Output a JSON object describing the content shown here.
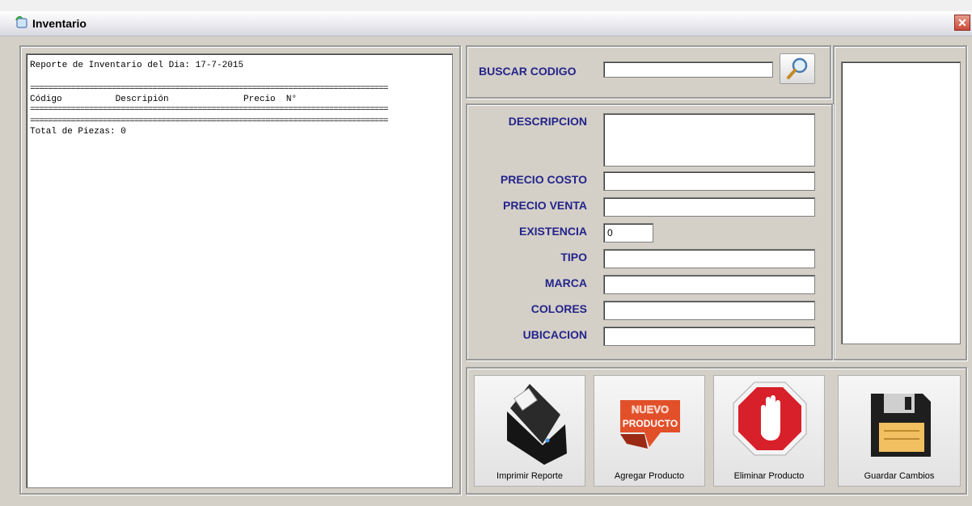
{
  "window": {
    "title": "Inventario",
    "close_glyph": "✕"
  },
  "report": {
    "lines": [
      "Reporte de Inventario del Dia: 17-7-2015",
      "",
      "===============================================================================",
      "Código          Descripión              Precio  N°",
      "===============================================================================",
      "===============================================================================",
      "Total de Piezas: 0"
    ]
  },
  "search": {
    "label": "BUSCAR CODIGO",
    "value": ""
  },
  "form": {
    "descripcion_label": "DESCRIPCION",
    "precio_costo_label": "PRECIO COSTO",
    "precio_venta_label": "PRECIO VENTA",
    "existencia_label": "EXISTENCIA",
    "existencia_value": "0",
    "tipo_label": "TIPO",
    "marca_label": "MARCA",
    "colores_label": "COLORES",
    "ubicacion_label": "UBICACION"
  },
  "actions": {
    "print_label": "Imprimir Reporte",
    "add_label": "Agregar Producto",
    "add_badge_top": "NUEVO",
    "add_badge_bottom": "PRODUCTO",
    "delete_label": "Eliminar Producto",
    "save_label": "Guardar Cambios"
  },
  "icons": {
    "app": "window-app-icon",
    "search": "magnifier-icon",
    "print": "receipt-printer-icon",
    "add": "new-product-badge-icon",
    "delete": "stop-hand-icon",
    "save": "floppy-disk-icon"
  },
  "colors": {
    "label_text": "#24248a",
    "panel": "#d4d0c8",
    "stop_red": "#d8202a"
  }
}
